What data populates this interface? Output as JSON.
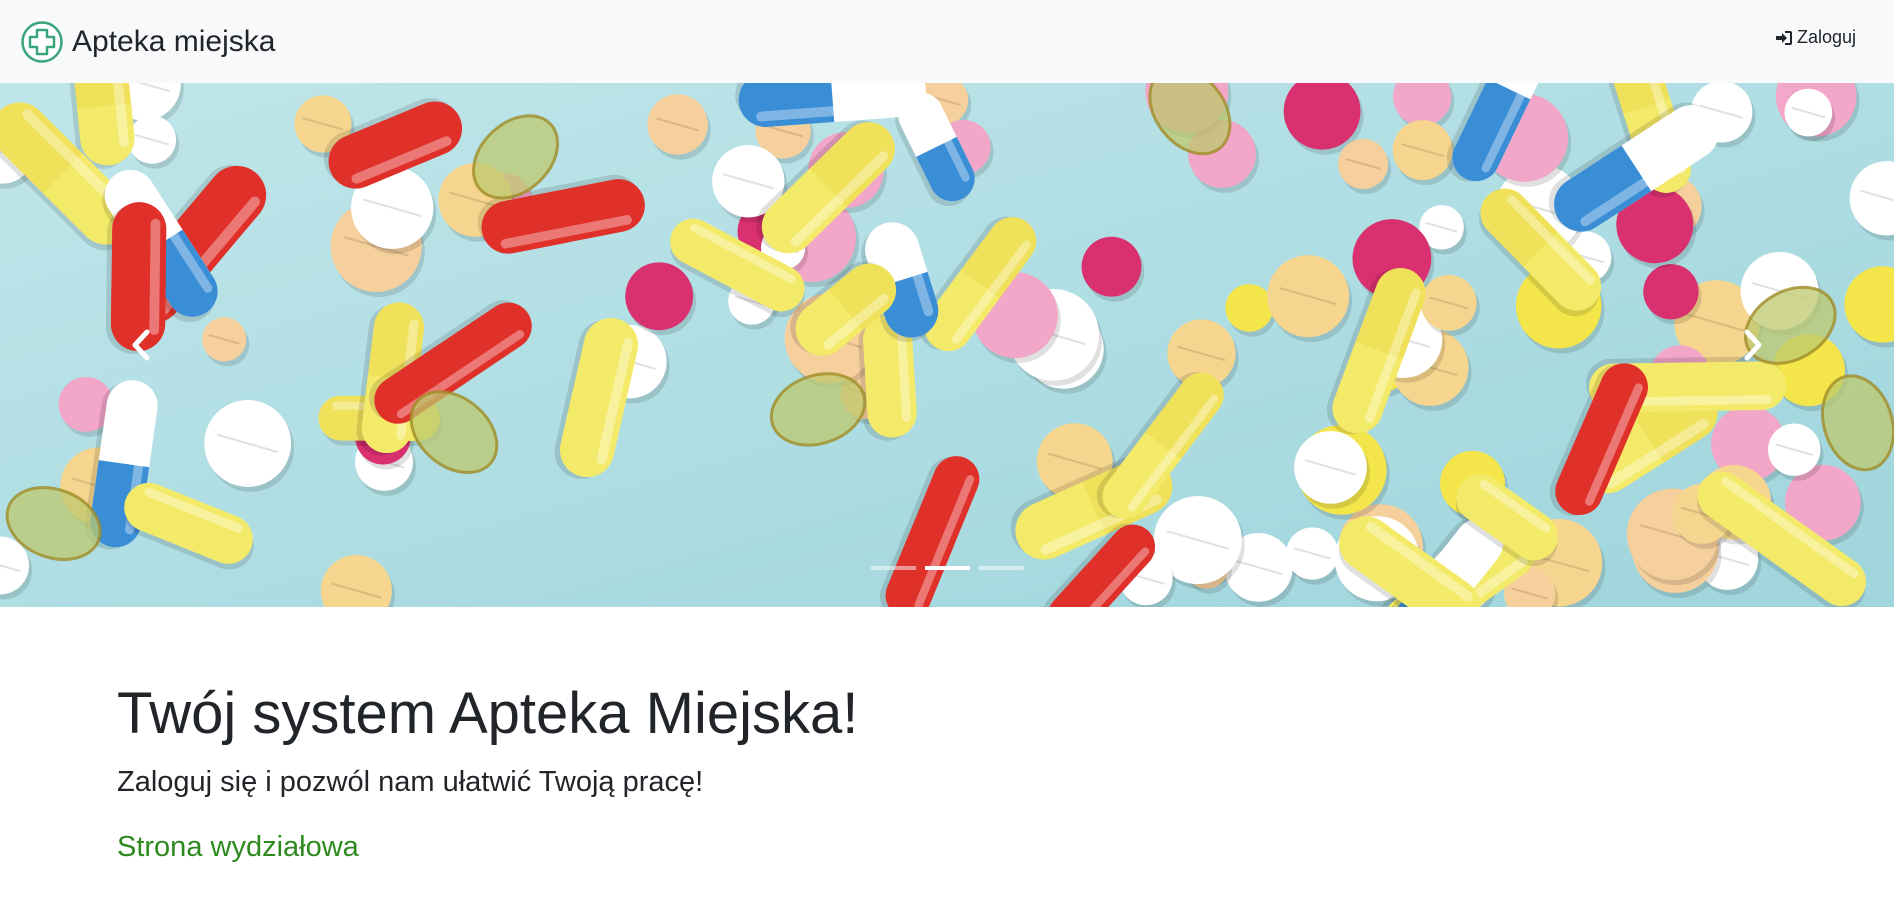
{
  "navbar": {
    "brand_text": "Apteka miejska",
    "brand_logo_icon": "pharmacy-cross-icon",
    "login_label": "Zaloguj",
    "login_icon": "sign-in-icon"
  },
  "carousel": {
    "image_icon": "pills-photo",
    "prev_icon": "chevron-left-icon",
    "next_icon": "chevron-right-icon",
    "slides_count": 3,
    "active_slide": 2
  },
  "main": {
    "headline": "Twój system Apteka Miejska!",
    "lead": "Zaloguj się i pozwól nam ułatwić Twoją pracę!",
    "department_link": "Strona wydziałowa"
  },
  "colors": {
    "navbar_bg": "#f8f9fa",
    "brand_green": "#3aa57a",
    "link_green": "#2e8a1f",
    "carousel_bg": "#a8dde3"
  }
}
